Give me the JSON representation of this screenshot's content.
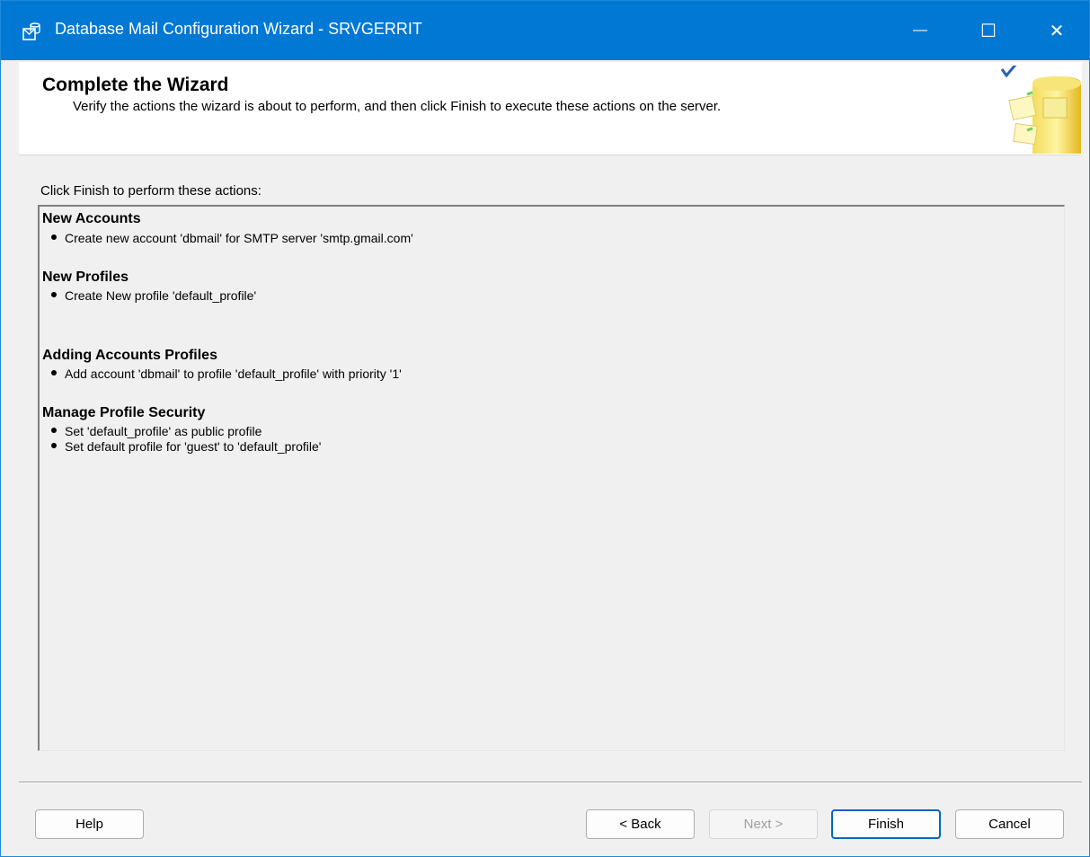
{
  "window": {
    "title": "Database Mail Configuration Wizard - SRVGERRIT",
    "controls": {
      "minimize": "—",
      "maximize": "☐",
      "close": "✕"
    }
  },
  "header": {
    "title": "Complete the Wizard",
    "description": "Verify the actions the wizard is about to perform, and then click Finish to execute these actions on the server."
  },
  "main": {
    "instruction": "Click Finish to perform these actions:",
    "sections": [
      {
        "heading": "New Accounts",
        "items": [
          "Create new account 'dbmail' for SMTP server 'smtp.gmail.com'"
        ]
      },
      {
        "heading": "New Profiles",
        "items": [
          "Create New profile 'default_profile'"
        ]
      },
      {
        "heading": "Adding Accounts Profiles",
        "items": [
          "Add account 'dbmail' to profile 'default_profile' with priority '1'"
        ]
      },
      {
        "heading": "Manage Profile Security",
        "items": [
          "Set 'default_profile' as public profile",
          "Set default profile for 'guest' to 'default_profile'"
        ]
      }
    ]
  },
  "buttons": {
    "help": "Help",
    "back": "< Back",
    "next": "Next >",
    "finish": "Finish",
    "cancel": "Cancel"
  },
  "colors": {
    "titlebar": "#0078d4",
    "accent_check": "#2b5fb4",
    "database_gold": "#e8c42e"
  },
  "icons": {
    "app": "database-mail-icon",
    "header_art": "database-check-icon"
  }
}
